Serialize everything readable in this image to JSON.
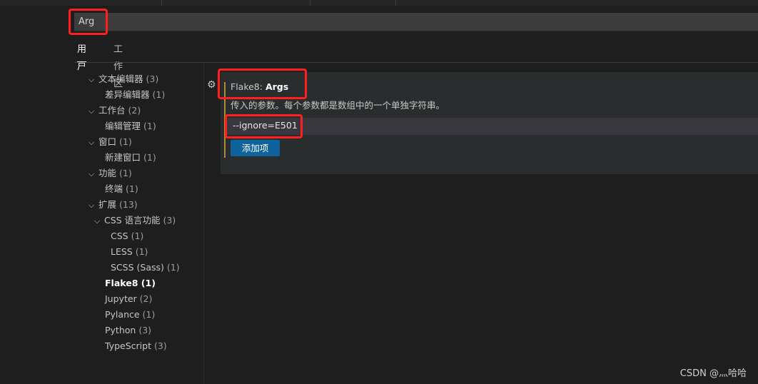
{
  "search": {
    "query": "Arg"
  },
  "tabs": [
    {
      "label": "用户",
      "active": true
    },
    {
      "label": "工作区",
      "active": false
    }
  ],
  "toc": [
    {
      "label": "文本编辑器",
      "count": "(3)",
      "level": 0,
      "expanded": true
    },
    {
      "label": "差异编辑器",
      "count": "(1)",
      "level": 1
    },
    {
      "label": "工作台",
      "count": "(2)",
      "level": 0,
      "expanded": true
    },
    {
      "label": "编辑管理",
      "count": "(1)",
      "level": 1
    },
    {
      "label": "窗口",
      "count": "(1)",
      "level": 0,
      "expanded": true
    },
    {
      "label": "新建窗口",
      "count": "(1)",
      "level": 1
    },
    {
      "label": "功能",
      "count": "(1)",
      "level": 0,
      "expanded": true
    },
    {
      "label": "终端",
      "count": "(1)",
      "level": 1
    },
    {
      "label": "扩展",
      "count": "(13)",
      "level": 0,
      "expanded": true
    },
    {
      "label": "CSS 语言功能",
      "count": "(3)",
      "level": 1,
      "expanded": true
    },
    {
      "label": "CSS",
      "count": "(1)",
      "level": 2
    },
    {
      "label": "LESS",
      "count": "(1)",
      "level": 2
    },
    {
      "label": "SCSS (Sass)",
      "count": "(1)",
      "level": 2
    },
    {
      "label": "Flake8",
      "count": "(1)",
      "level": 1,
      "active": true
    },
    {
      "label": "Jupyter",
      "count": "(2)",
      "level": 1
    },
    {
      "label": "Pylance",
      "count": "(1)",
      "level": 1
    },
    {
      "label": "Python",
      "count": "(3)",
      "level": 1
    },
    {
      "label": "TypeScript",
      "count": "(3)",
      "level": 1
    }
  ],
  "setting": {
    "category": "Flake8: ",
    "name": "Args",
    "description": "传入的参数。每个参数都是数组中的一个单独字符串。",
    "items": [
      "--ignore=E501"
    ],
    "add_button_label": "添加项"
  },
  "watermark": "CSDN @灬哈哈",
  "colors": {
    "background": "#1e1e1e",
    "button": "#0e639c",
    "highlight_box": "#ff1f1f",
    "modified_bar": "#ad8b36"
  },
  "icons": {
    "chevron": "chevron-down-icon",
    "gear": "gear-icon"
  }
}
